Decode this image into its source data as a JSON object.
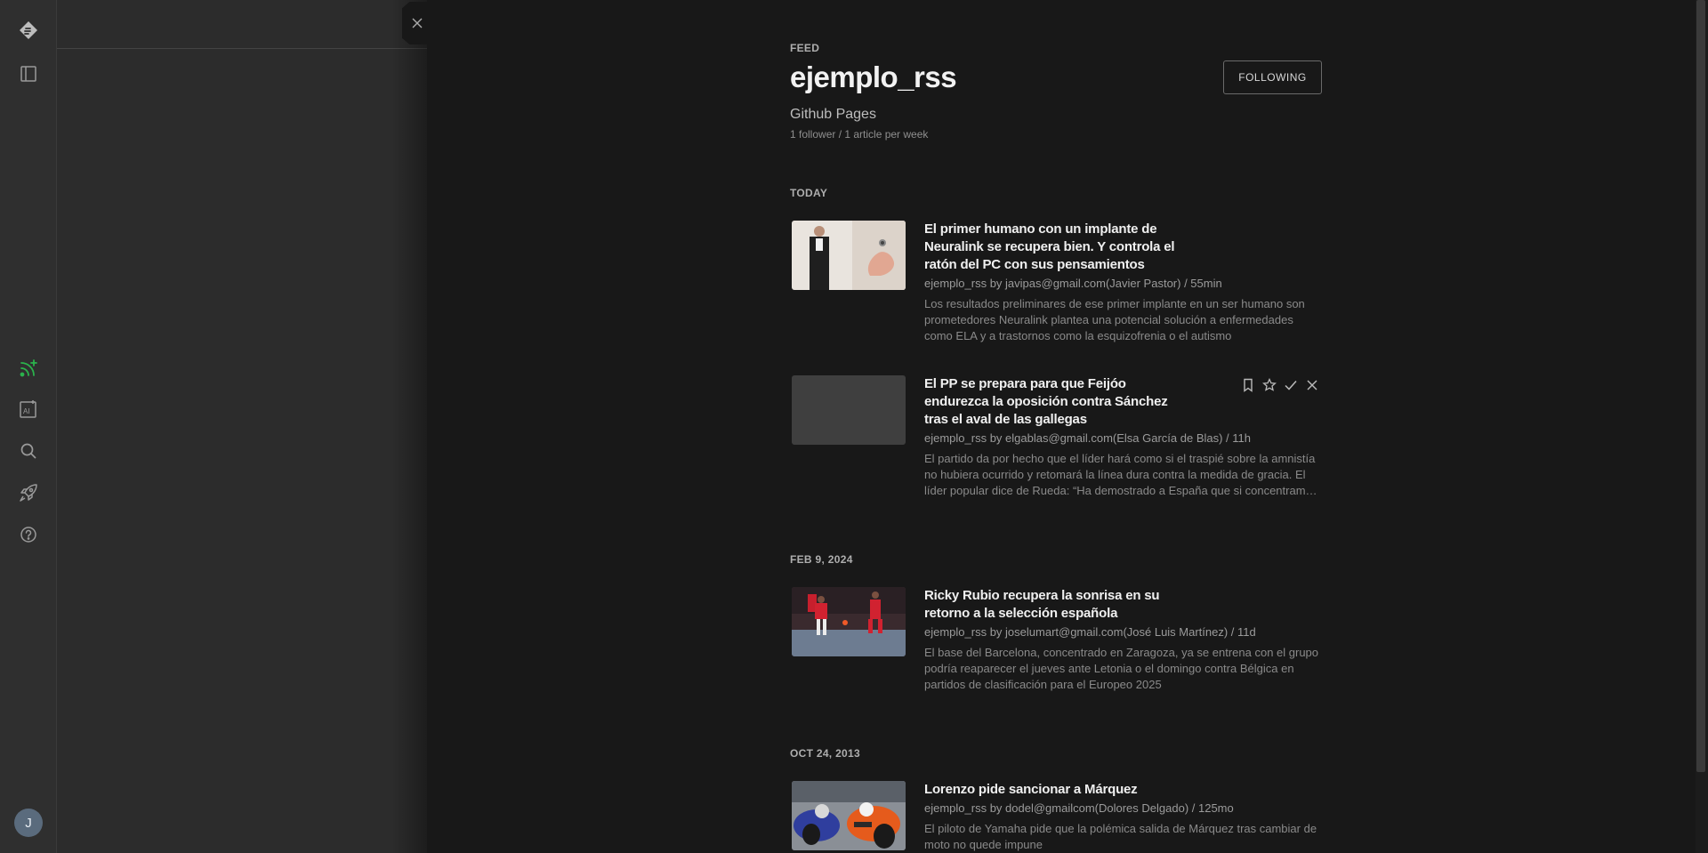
{
  "feed": {
    "label": "FEED",
    "title": "ejemplo_rss",
    "source": "Github Pages",
    "stats": "1 follower / 1 article per week",
    "follow_button": "FOLLOWING"
  },
  "sections": [
    {
      "label": "TODAY",
      "articles": [
        {
          "title": "El primer humano con un implante de Neuralink se recupera bien. Y controla el ratón del PC con sus pensamientos",
          "meta": "ejemplo_rss by javipas@gmail.com(Javier Pastor) / 55min",
          "description": "Los resultados preliminares de ese primer implante en un ser humano son prometedores Neuralink plantea una potencial solución a enfermedades como ELA y a trastornos como la esquizofrenia o el autismo"
        },
        {
          "title": "El PP se prepara para que Feijóo endurezca la oposición contra Sánchez tras el aval de las gallegas",
          "meta": "ejemplo_rss by elgablas@gmail.com(Elsa García de Blas) / 11h",
          "description": "El partido da por hecho que el líder hará como si el traspié sobre la amnistía no hubiera ocurrido y retomará la línea dura contra la medida de gracia. El líder popular dice de Rueda: “Ha demostrado a España que si concentram…"
        }
      ]
    },
    {
      "label": "FEB 9, 2024",
      "articles": [
        {
          "title": "Ricky Rubio recupera la sonrisa en su retorno a la selección española",
          "meta": "ejemplo_rss by joselumart@gmail.com(José Luis Martínez) / 11d",
          "description": "El base del Barcelona, concentrado en Zaragoza, ya se entrena con el grupo podría reaparecer el jueves ante Letonia o el domingo contra Bélgica en partidos de clasificación para el Europeo 2025"
        }
      ]
    },
    {
      "label": "OCT 24, 2013",
      "articles": [
        {
          "title": "Lorenzo pide sancionar a Márquez",
          "meta": "ejemplo_rss by dodel@gmailcom(Dolores Delgado) / 125mo",
          "description": "El piloto de Yamaha pide que la polémica salida de Márquez tras cambiar de moto no quede impune"
        }
      ]
    }
  ],
  "sidebar": {
    "avatar_letter": "J",
    "icons": [
      "feedly-logo-icon",
      "sidebar-toggle-icon",
      "add-feed-icon",
      "ai-feed-icon",
      "search-icon",
      "rocket-icon",
      "help-icon"
    ]
  },
  "colors": {
    "accent_green": "#2bb24c",
    "background": "#181818",
    "rail": "#2f2f2f"
  }
}
